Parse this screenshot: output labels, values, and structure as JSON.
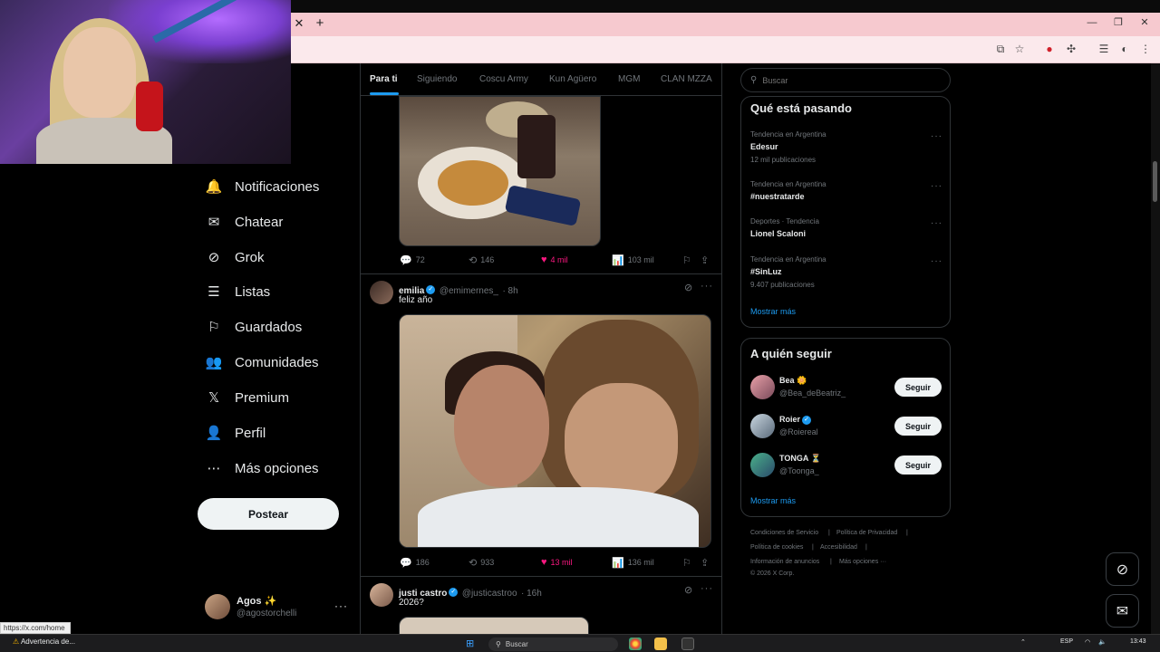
{
  "browser": {
    "close_tab_glyph": "✕",
    "new_tab_glyph": "+",
    "minimize_glyph": "—",
    "maximize_glyph": "❐",
    "close_window_glyph": "✕",
    "url_tooltip": "https://x.com/home"
  },
  "nav": {
    "items": [
      {
        "label": "Notificaciones",
        "icon": "bell-icon",
        "glyph": "🔔"
      },
      {
        "label": "Chatear",
        "icon": "mail-icon",
        "glyph": "✉"
      },
      {
        "label": "Grok",
        "icon": "grok-icon",
        "glyph": "⊘"
      },
      {
        "label": "Listas",
        "icon": "list-icon",
        "glyph": "☰"
      },
      {
        "label": "Guardados",
        "icon": "bookmark-icon",
        "glyph": "⚐"
      },
      {
        "label": "Comunidades",
        "icon": "people-icon",
        "glyph": "👥"
      },
      {
        "label": "Premium",
        "icon": "x-logo-icon",
        "glyph": "𝕏"
      },
      {
        "label": "Perfil",
        "icon": "person-icon",
        "glyph": "👤"
      },
      {
        "label": "Más opciones",
        "icon": "more-circle-icon",
        "glyph": "⋯"
      }
    ],
    "post_button": "Postear",
    "me": {
      "name": "Agos ✨",
      "handle": "@agostorchelli",
      "more": "···"
    }
  },
  "tabs": [
    "Para ti",
    "Siguiendo",
    "Coscu Army",
    "Kun Agüero",
    "MGM",
    "CLAN MZZA"
  ],
  "tweets": [
    {
      "stats": {
        "replies": "72",
        "retweets": "146",
        "likes": "4 mil",
        "views": "103 mil"
      }
    },
    {
      "name": "emilia",
      "handle": "@emimernes_",
      "time": "· 8h",
      "text": "feliz año",
      "stats": {
        "replies": "186",
        "retweets": "933",
        "likes": "13 mil",
        "views": "136 mil"
      }
    },
    {
      "name": "justi castro",
      "handle": "@justicastroo",
      "time": "· 16h",
      "text": "2026?"
    }
  ],
  "search": {
    "placeholder": "Buscar"
  },
  "trends": {
    "title": "Qué está pasando",
    "items": [
      {
        "context": "Tendencia en Argentina",
        "name": "Edesur",
        "count": "12 mil publicaciones"
      },
      {
        "context": "Tendencia en Argentina",
        "name": "#nuestratarde",
        "count": ""
      },
      {
        "context": "Deportes · Tendencia",
        "name": "Lionel Scaloni",
        "count": ""
      },
      {
        "context": "Tendencia en Argentina",
        "name": "#SinLuz",
        "count": "9.407 publicaciones"
      }
    ],
    "show_more": "Mostrar más"
  },
  "who_to_follow": {
    "title": "A quién seguir",
    "items": [
      {
        "name": "Bea 🌼",
        "handle": "@Bea_deBeatriz_",
        "button": "Seguir"
      },
      {
        "name": "Roier",
        "handle": "@Roiereal",
        "button": "Seguir"
      },
      {
        "name": "TONGA ⏳",
        "handle": "@Toonga_",
        "button": "Seguir"
      }
    ],
    "show_more": "Mostrar más"
  },
  "footer": {
    "links": [
      "Condiciones de Servicio",
      "Política de Privacidad",
      "Política de cookies",
      "Accesibilidad",
      "Información de anuncios",
      "Más opciones ···"
    ],
    "copyright": "© 2026 X Corp."
  },
  "taskbar": {
    "warning": "Advertencia de...",
    "search_placeholder": "Buscar",
    "lang": "ESP",
    "time": "13:43"
  },
  "colors": {
    "accent": "#1d9bf0",
    "like": "#f91880",
    "tab_bar": "#f6c9cf"
  }
}
